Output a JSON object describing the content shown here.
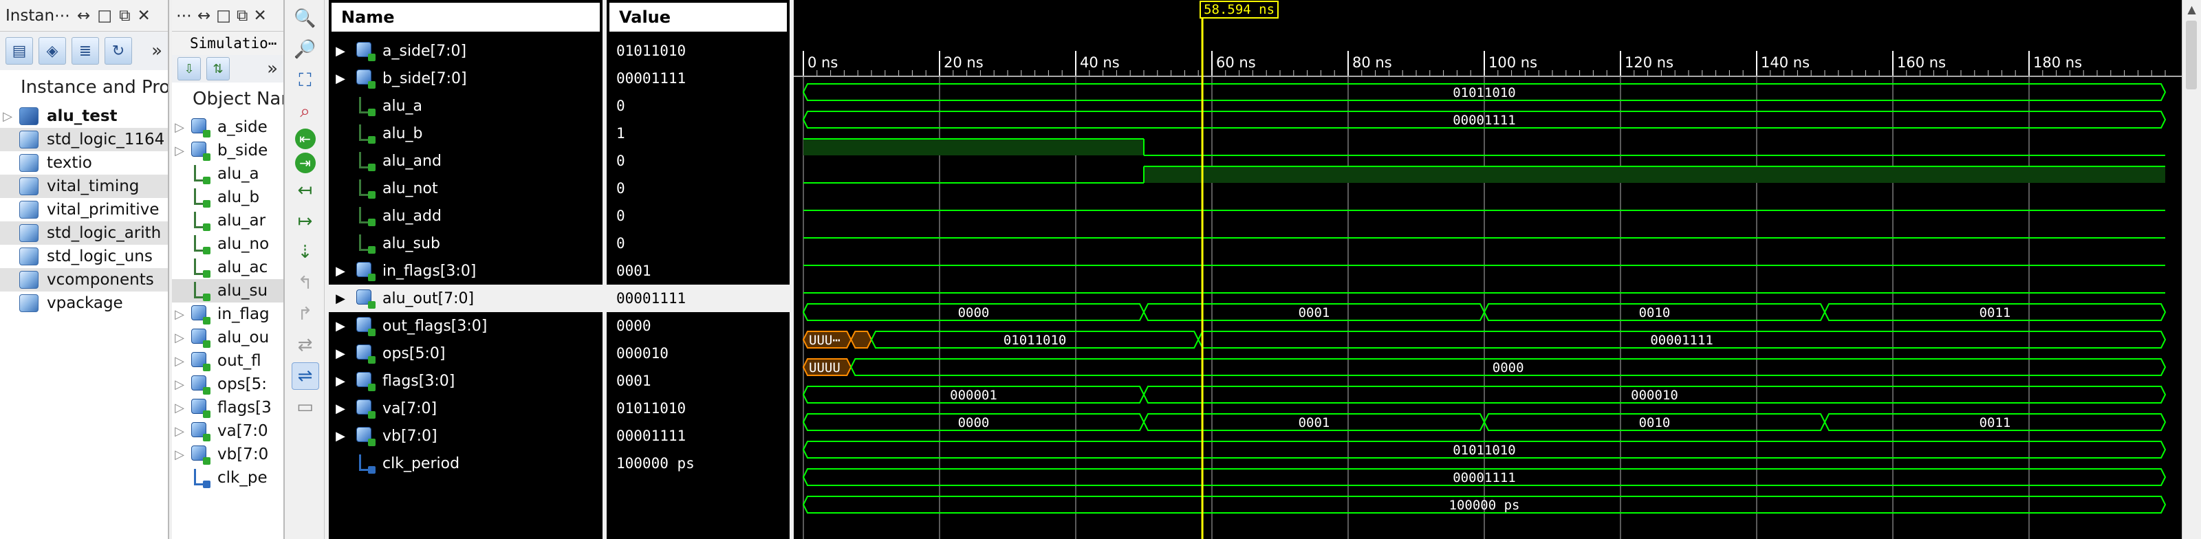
{
  "instances_panel": {
    "title": "Instan⋯",
    "header": "Instance and Proc",
    "items": [
      {
        "label": "alu_test",
        "bold": true,
        "shaded": false
      },
      {
        "label": "std_logic_1164",
        "bold": false,
        "shaded": true
      },
      {
        "label": "textio",
        "bold": false,
        "shaded": false
      },
      {
        "label": "vital_timing",
        "bold": false,
        "shaded": true
      },
      {
        "label": "vital_primitive",
        "bold": false,
        "shaded": false
      },
      {
        "label": "std_logic_arith",
        "bold": false,
        "shaded": true
      },
      {
        "label": "std_logic_uns",
        "bold": false,
        "shaded": false
      },
      {
        "label": "vcomponents",
        "bold": false,
        "shaded": true
      },
      {
        "label": "vpackage",
        "bold": false,
        "shaded": false
      }
    ]
  },
  "objects_panel": {
    "title": "Simulatio⋯",
    "ellipsis": "⋯",
    "header": "Object Nan",
    "items": [
      {
        "label": "a_side",
        "kind": "bus"
      },
      {
        "label": "b_side",
        "kind": "bus"
      },
      {
        "label": "alu_a",
        "kind": "bit"
      },
      {
        "label": "alu_b",
        "kind": "bit"
      },
      {
        "label": "alu_ar",
        "kind": "bit"
      },
      {
        "label": "alu_no",
        "kind": "bit"
      },
      {
        "label": "alu_ac",
        "kind": "bit"
      },
      {
        "label": "alu_su",
        "kind": "bit"
      },
      {
        "label": "in_flag",
        "kind": "bus"
      },
      {
        "label": "alu_ou",
        "kind": "bus"
      },
      {
        "label": "out_fl",
        "kind": "bus"
      },
      {
        "label": "ops[5:",
        "kind": "bus"
      },
      {
        "label": "flags[3",
        "kind": "bus"
      },
      {
        "label": "va[7:0",
        "kind": "bus"
      },
      {
        "label": "vb[7:0",
        "kind": "bus"
      },
      {
        "label": "clk_pe",
        "kind": "const"
      }
    ]
  },
  "wave_columns": {
    "name_header": "Name",
    "value_header": "Value"
  },
  "signals": [
    {
      "name": "a_side[7:0]",
      "value": "01011010",
      "kind": "bus"
    },
    {
      "name": "b_side[7:0]",
      "value": "00001111",
      "kind": "bus"
    },
    {
      "name": "alu_a",
      "value": "0",
      "kind": "bit"
    },
    {
      "name": "alu_b",
      "value": "1",
      "kind": "bit"
    },
    {
      "name": "alu_and",
      "value": "0",
      "kind": "bit"
    },
    {
      "name": "alu_not",
      "value": "0",
      "kind": "bit"
    },
    {
      "name": "alu_add",
      "value": "0",
      "kind": "bit"
    },
    {
      "name": "alu_sub",
      "value": "0",
      "kind": "bit"
    },
    {
      "name": "in_flags[3:0]",
      "value": "0001",
      "kind": "bus"
    },
    {
      "name": "alu_out[7:0]",
      "value": "00001111",
      "kind": "bus",
      "selected": true
    },
    {
      "name": "out_flags[3:0]",
      "value": "0000",
      "kind": "bus"
    },
    {
      "name": "ops[5:0]",
      "value": "000010",
      "kind": "bus"
    },
    {
      "name": "flags[3:0]",
      "value": "0001",
      "kind": "bus"
    },
    {
      "name": "va[7:0]",
      "value": "01011010",
      "kind": "bus"
    },
    {
      "name": "vb[7:0]",
      "value": "00001111",
      "kind": "bus"
    },
    {
      "name": "clk_period",
      "value": "100000 ps",
      "kind": "const"
    }
  ],
  "timeline": {
    "unit": "ns",
    "start": 0,
    "end": 200,
    "ticks": [
      0,
      20,
      40,
      60,
      80,
      100,
      120,
      140,
      160,
      180
    ],
    "tick_labels": [
      "0 ns",
      "20 ns",
      "40 ns",
      "60 ns",
      "80 ns",
      "100 ns",
      "120 ns",
      "140 ns",
      "160 ns",
      "180 ns"
    ],
    "cursor_time": 58.594,
    "cursor_label": "58.594 ns"
  },
  "waveforms": [
    {
      "type": "bus",
      "segments": [
        {
          "start": 0,
          "end": 200,
          "label": "01011010"
        }
      ]
    },
    {
      "type": "bus",
      "segments": [
        {
          "start": 0,
          "end": 200,
          "label": "00001111"
        }
      ]
    },
    {
      "type": "bit",
      "transitions": [
        [
          0,
          1
        ],
        [
          50,
          0
        ]
      ]
    },
    {
      "type": "bit",
      "transitions": [
        [
          0,
          0
        ],
        [
          50,
          1
        ]
      ]
    },
    {
      "type": "bit",
      "transitions": [
        [
          0,
          0
        ]
      ]
    },
    {
      "type": "bit",
      "transitions": [
        [
          0,
          0
        ]
      ]
    },
    {
      "type": "bit",
      "transitions": [
        [
          0,
          0
        ]
      ]
    },
    {
      "type": "bit",
      "transitions": [
        [
          0,
          0
        ]
      ]
    },
    {
      "type": "bus",
      "segments": [
        {
          "start": 0,
          "end": 50,
          "label": "0000"
        },
        {
          "start": 50,
          "end": 100,
          "label": "0001"
        },
        {
          "start": 100,
          "end": 150,
          "label": "0010"
        },
        {
          "start": 150,
          "end": 200,
          "label": "0011"
        }
      ]
    },
    {
      "type": "bus",
      "segments": [
        {
          "start": 0,
          "end": 7,
          "label": "UUU⋯",
          "state": "undefined"
        },
        {
          "start": 7,
          "end": 10,
          "label": "",
          "state": "undefined"
        },
        {
          "start": 10,
          "end": 58,
          "label": "01011010"
        },
        {
          "start": 58,
          "end": 200,
          "label": "00001111"
        }
      ]
    },
    {
      "type": "bus",
      "segments": [
        {
          "start": 0,
          "end": 7,
          "label": "UUUU",
          "state": "undefined"
        },
        {
          "start": 7,
          "end": 200,
          "label": "0000"
        }
      ]
    },
    {
      "type": "bus",
      "segments": [
        {
          "start": 0,
          "end": 50,
          "label": "000001"
        },
        {
          "start": 50,
          "end": 200,
          "label": "000010"
        }
      ]
    },
    {
      "type": "bus",
      "segments": [
        {
          "start": 0,
          "end": 50,
          "label": "0000"
        },
        {
          "start": 50,
          "end": 100,
          "label": "0001"
        },
        {
          "start": 100,
          "end": 150,
          "label": "0010"
        },
        {
          "start": 150,
          "end": 200,
          "label": "0011"
        }
      ]
    },
    {
      "type": "bus",
      "segments": [
        {
          "start": 0,
          "end": 200,
          "label": "01011010"
        }
      ]
    },
    {
      "type": "bus",
      "segments": [
        {
          "start": 0,
          "end": 200,
          "label": "00001111"
        }
      ]
    },
    {
      "type": "bus",
      "segments": [
        {
          "start": 0,
          "end": 200,
          "label": "100000 ps"
        }
      ]
    }
  ],
  "colors": {
    "wave": "#00ff00",
    "undefined": "#ff8c00",
    "cursor": "#ffff00",
    "grid": "#5a5a5a",
    "highlight_fill": "#0b3d0b"
  }
}
